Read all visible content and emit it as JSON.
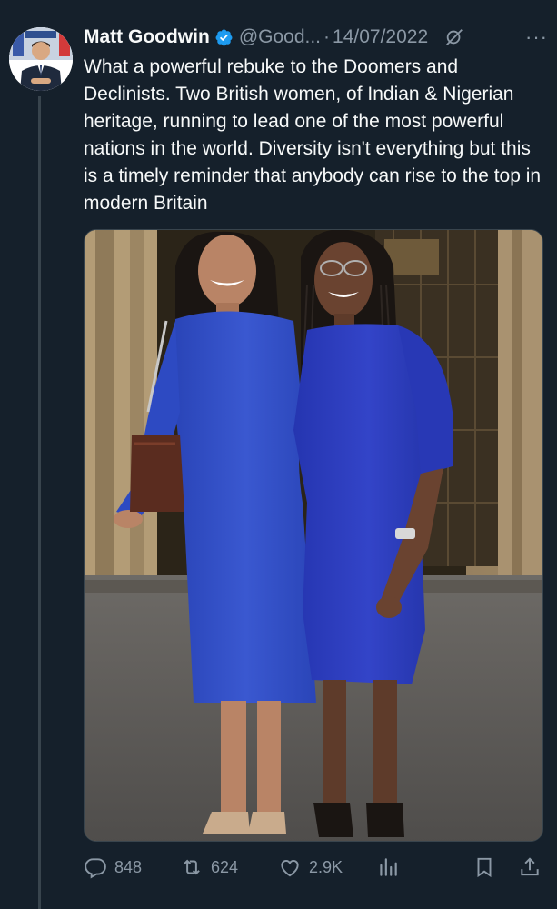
{
  "tweet": {
    "author_name": "Matt Goodwin",
    "handle": "@Good...",
    "separator": "·",
    "date": "14/07/2022",
    "more_label": "···",
    "text": "What a powerful rebuke to the Doomers and Declinists. Two British women, of Indian & Nigerian heritage, running to lead one of the most powerful nations in the world. Diversity isn't everything but this is a timely reminder that anybody can rise to the top in modern Britain"
  },
  "actions": {
    "replies": "848",
    "retweets": "624",
    "likes": "2.9K"
  },
  "icons": {
    "verified": "verified-badge-icon",
    "grok": "grok-icon",
    "more": "more-icon",
    "reply": "reply-icon",
    "retweet": "retweet-icon",
    "like": "heart-icon",
    "views": "views-icon",
    "bookmark": "bookmark-icon",
    "share": "share-icon"
  },
  "colors": {
    "background": "#15202b",
    "primary_text": "#f7f9f9",
    "secondary_text": "#8b98a5",
    "verified_blue": "#1d9bf0",
    "divider": "#38444d"
  }
}
